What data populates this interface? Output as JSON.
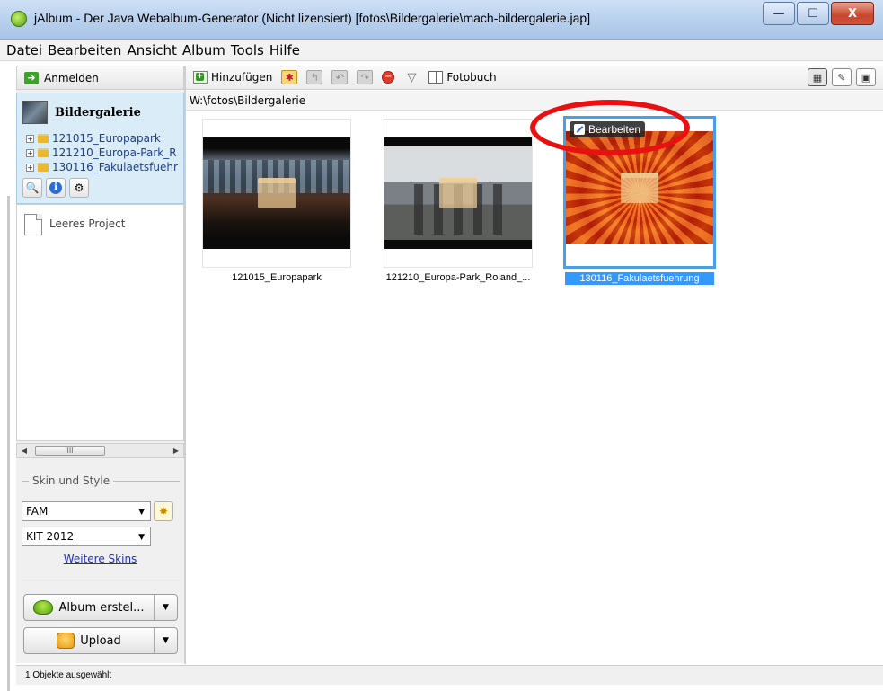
{
  "window": {
    "title": "jAlbum - Der Java Webalbum-Generator (Nicht lizensiert) [fotos\\Bildergalerie\\mach-bildergalerie.jap]",
    "minimize": "—",
    "maximize": "☐",
    "close": "X"
  },
  "menu": {
    "items": [
      "Datei",
      "Bearbeiten",
      "Ansicht",
      "Album",
      "Tools",
      "Hilfe"
    ]
  },
  "sidebar": {
    "signin_label": "Anmelden",
    "project": {
      "title": "Bildergalerie",
      "tree": [
        {
          "label": "121015_Europapark"
        },
        {
          "label": "121210_Europa-Park_R"
        },
        {
          "label": "130116_Fakulaetsfuehr"
        }
      ]
    },
    "empty_project_label": "Leeres Project",
    "skin_section_label": "Skin und Style",
    "skin_value": "FAM",
    "style_value": "KIT 2012",
    "more_skins_label": "Weitere Skins",
    "make_album_label": "Album erstel...",
    "upload_label": "Upload"
  },
  "toolbar": {
    "add_label": "Hinzufügen",
    "photobook_label": "Fotobuch"
  },
  "path": "W:\\fotos\\Bildergalerie",
  "thumbnails": [
    {
      "label": "121015_Europapark"
    },
    {
      "label": "121210_Europa-Park_Roland_..."
    },
    {
      "label": "130116_Fakulaetsfuehrung"
    }
  ],
  "edit_badge_label": "Bearbeiten",
  "status": "1 Objekte ausgewählt",
  "colors": {
    "selection": "#3399ff",
    "annotation": "#e81010"
  }
}
